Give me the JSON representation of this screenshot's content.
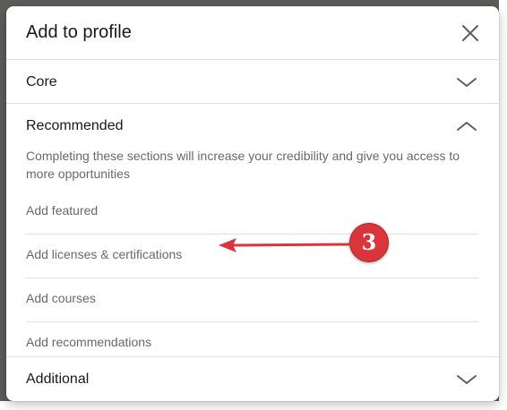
{
  "modal": {
    "title": "Add to profile",
    "close_icon": "close-icon"
  },
  "sections": {
    "core": {
      "label": "Core",
      "icon": "chevron-down-icon",
      "expanded": false
    },
    "recommended": {
      "label": "Recommended",
      "icon": "chevron-up-icon",
      "expanded": true,
      "description": "Completing these sections will increase your credibility and give you access to more opportunities",
      "items": [
        {
          "label": "Add featured"
        },
        {
          "label": "Add licenses & certifications"
        },
        {
          "label": "Add courses"
        },
        {
          "label": "Add recommendations"
        }
      ]
    },
    "additional": {
      "label": "Additional",
      "icon": "chevron-down-icon",
      "expanded": false
    }
  },
  "annotation": {
    "badge_number": "3",
    "color": "#d9353a"
  }
}
